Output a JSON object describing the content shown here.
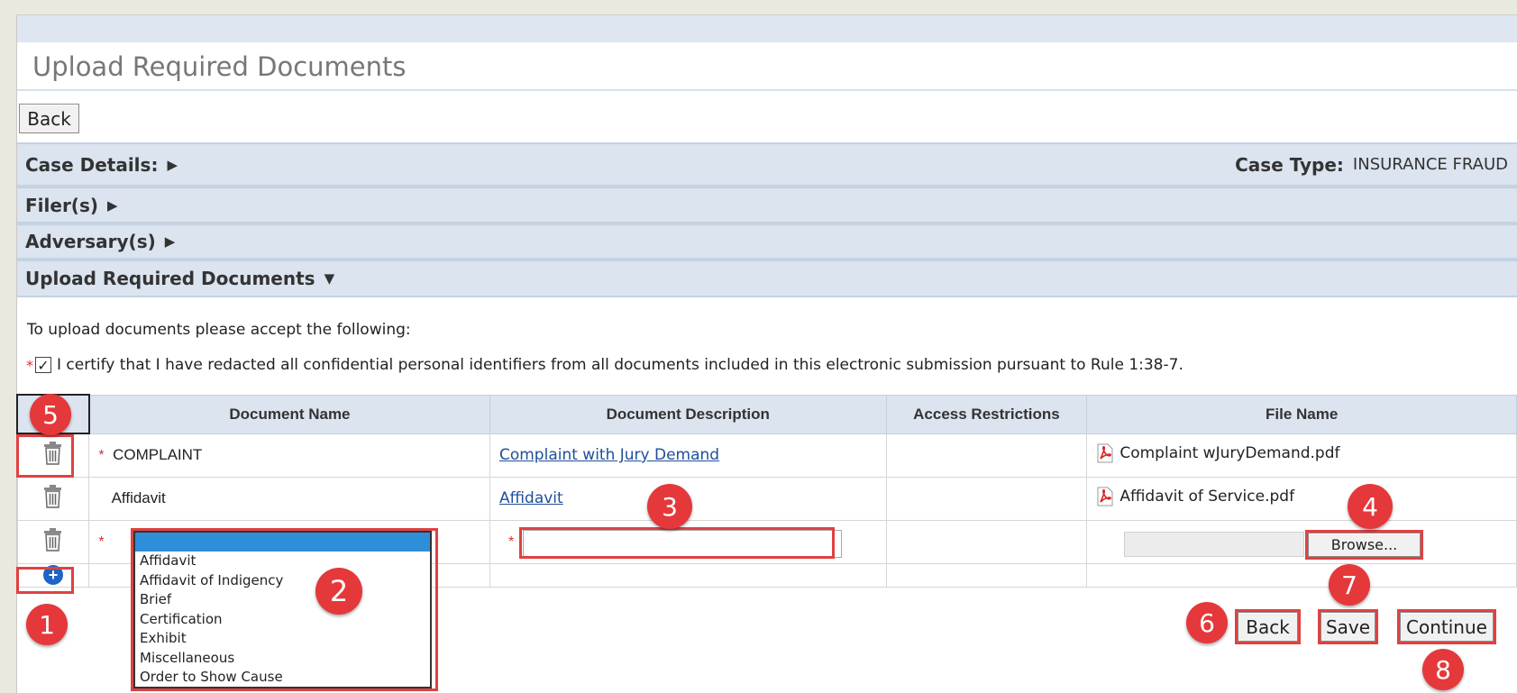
{
  "page": {
    "title": "Upload Required Documents"
  },
  "top": {
    "back_label": "Back"
  },
  "sections": {
    "case_details": "Case Details:",
    "case_type_label": "Case Type:",
    "case_type_value": "INSURANCE FRAUD",
    "filers": "Filer(s)",
    "adversary": "Adversary(s)",
    "upload": "Upload Required Documents"
  },
  "intro": "To upload documents please accept the following:",
  "certify": {
    "required_mark": "*",
    "text": "I certify that I have redacted all confidential personal identifiers from all documents included in this electronic submission pursuant to Rule 1:38-7."
  },
  "table": {
    "headers": [
      "Document Name",
      "Document Description",
      "Access Restrictions",
      "File Name"
    ],
    "rows": [
      {
        "required": "*",
        "name": "COMPLAINT",
        "description": "Complaint with Jury Demand",
        "file": "Complaint wJuryDemand.pdf"
      },
      {
        "required": "",
        "name": "Affidavit",
        "description": "Affidavit",
        "file": "Affidavit of Service.pdf"
      }
    ],
    "new_row": {
      "required": "*",
      "desc_required": "*",
      "browse_label": "Browse..."
    }
  },
  "dropdown": {
    "options": [
      "Affidavit",
      "Affidavit of Indigency",
      "Brief",
      "Certification",
      "Exhibit",
      "Miscellaneous",
      "Order to Show Cause"
    ]
  },
  "footer": {
    "back_label": "Back",
    "save_label": "Save",
    "continue_label": "Continue"
  },
  "badges": [
    "1",
    "2",
    "3",
    "4",
    "5",
    "6",
    "7",
    "8"
  ],
  "icons": {
    "trash": "trash-icon",
    "add": "add-circle-icon",
    "pdf": "pdf-icon",
    "check": "checkmark"
  },
  "colors": {
    "annotation_red": "#e5383b",
    "header_blue": "#dbe4ef",
    "link_blue": "#1f4e9a",
    "selection_blue": "#2f8ed8"
  }
}
